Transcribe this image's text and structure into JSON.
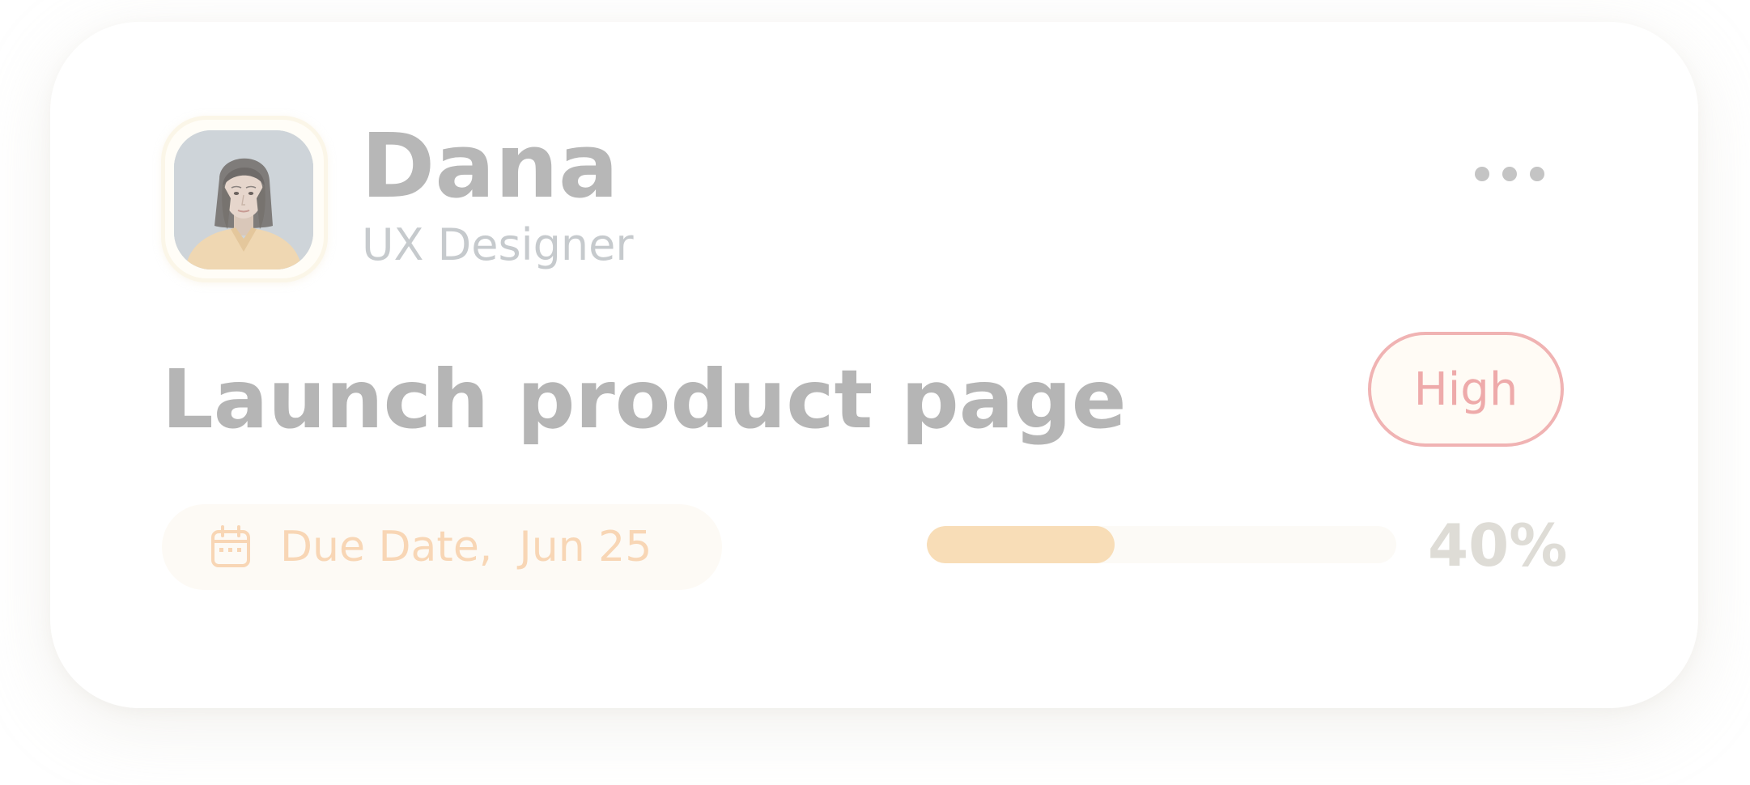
{
  "profile": {
    "name": "Dana",
    "role": "UX Designer",
    "avatar_alt": "avatar"
  },
  "menu": {
    "icon": "more-horizontal-icon"
  },
  "task": {
    "title": "Launch product page",
    "priority": "High",
    "due_label": "Due Date,",
    "due_date": "Jun 25",
    "due_text": "Due Date,  Jun 25",
    "calendar_icon": "calendar-icon",
    "progress_percent": 40,
    "progress_label": "40%"
  },
  "colors": {
    "priority_border": "#f0b3b3",
    "priority_text": "#eeaaaa",
    "due_accent": "#f8d6b5",
    "progress_fill": "#f8ddb7"
  }
}
